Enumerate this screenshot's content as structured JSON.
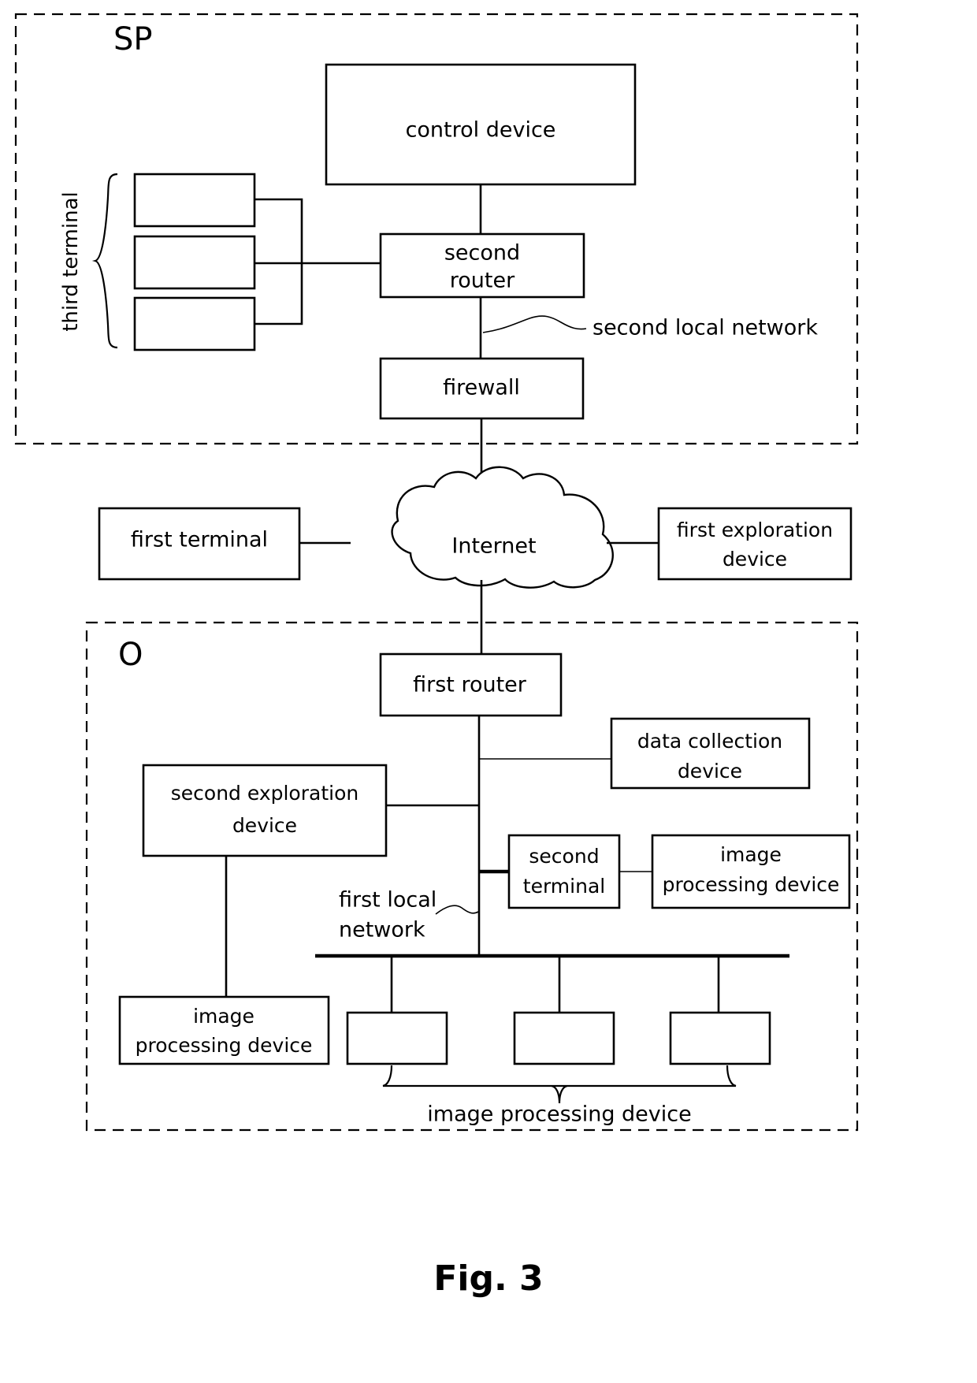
{
  "figure": {
    "caption": "Fig. 3"
  },
  "zones": [
    {
      "id": "sp",
      "label": "SP"
    },
    {
      "id": "o",
      "label": "O"
    }
  ],
  "nodes": {
    "control_device": "control device",
    "second_router_line1": "second",
    "second_router_line2": "router",
    "firewall": "firewall",
    "internet": "Internet",
    "first_terminal": "first terminal",
    "first_exploration_line1": "first exploration",
    "first_exploration_line2": "device",
    "first_router": "first router",
    "data_collection_line1": "data collection",
    "data_collection_line2": "device",
    "second_exploration_line1": "second exploration",
    "second_exploration_line2": "device",
    "second_terminal_line1": "second",
    "second_terminal_line2": "terminal",
    "image_processing_right_line1": "image",
    "image_processing_right_line2": "processing device",
    "image_processing_left_line1": "image",
    "image_processing_left_line2": "processing device",
    "third_terminal_1": "",
    "third_terminal_2": "",
    "third_terminal_3": "",
    "bottom_ipd_1": "",
    "bottom_ipd_2": "",
    "bottom_ipd_3": ""
  },
  "annotations": {
    "third_terminal": "third terminal",
    "second_local_network": "second local network",
    "first_local_network_line1": "first local",
    "first_local_network_line2": "network",
    "image_processing_device_group": "image processing device"
  },
  "colors": {
    "stroke": "#000000",
    "fill": "#ffffff",
    "background": "#ffffff"
  }
}
